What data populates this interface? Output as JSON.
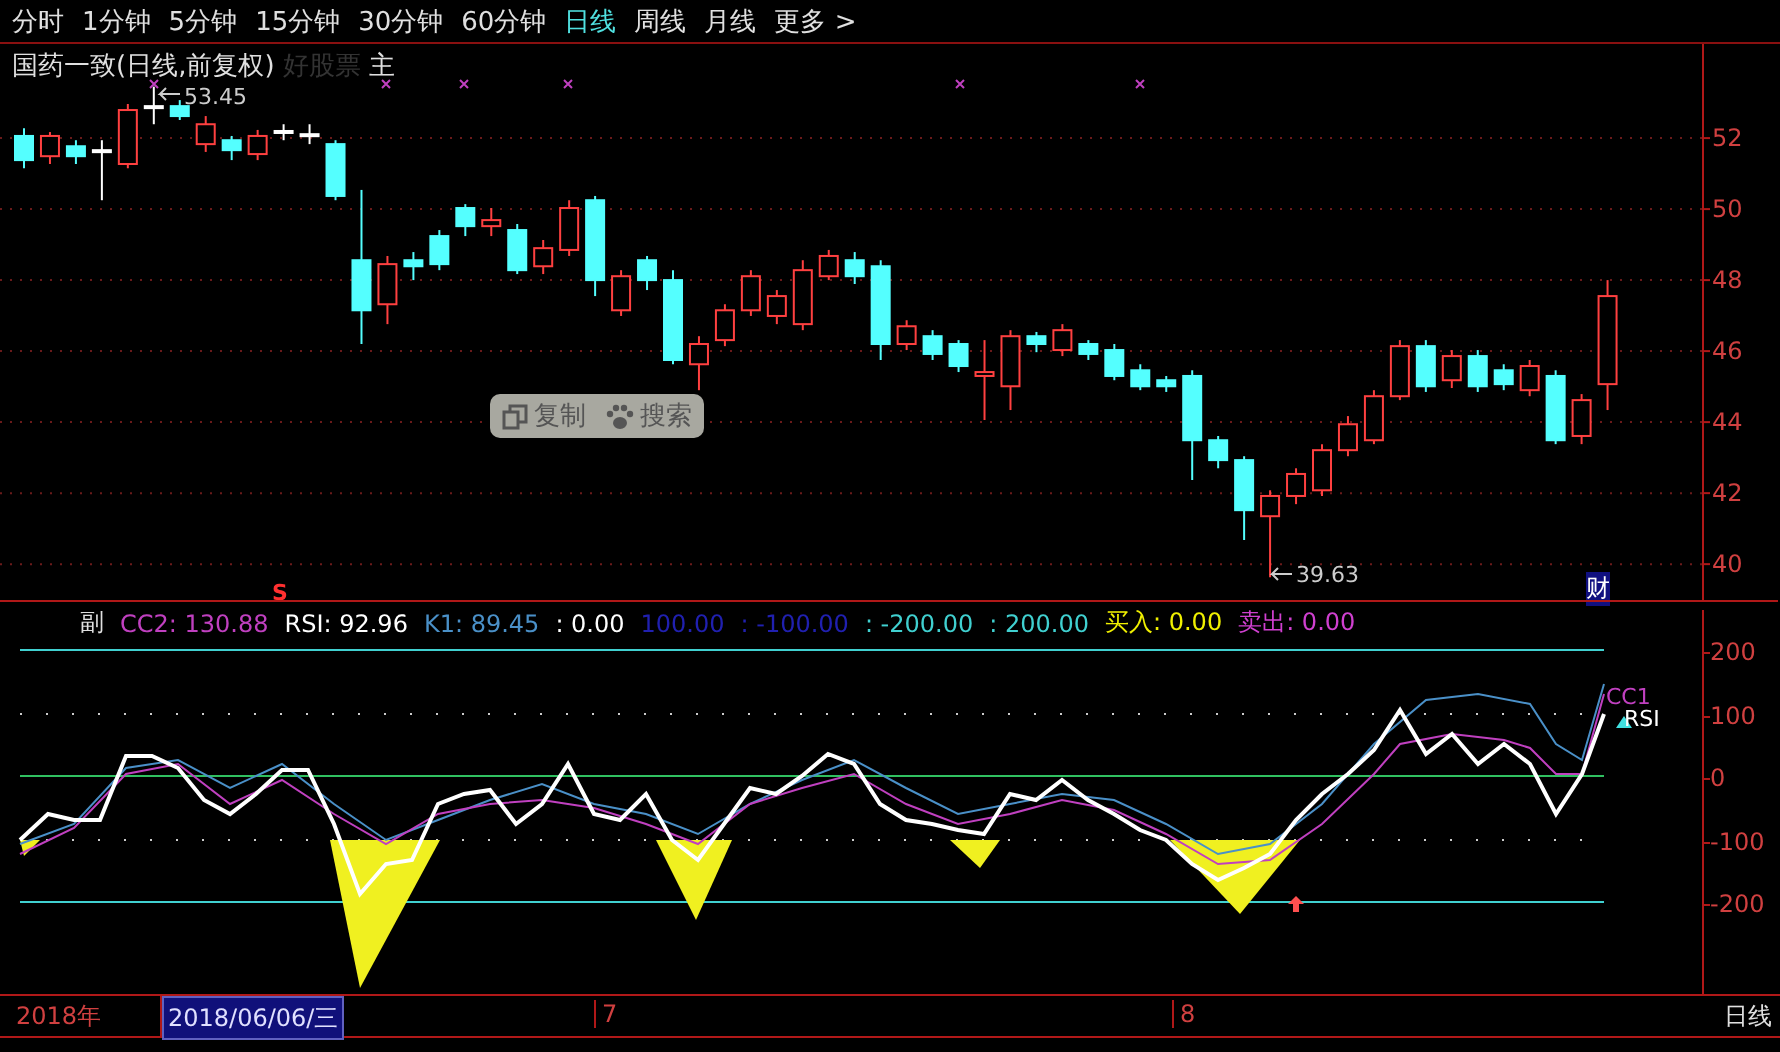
{
  "period_tabs": [
    {
      "label": "分时",
      "selected": false
    },
    {
      "label": "1分钟",
      "selected": false
    },
    {
      "label": "5分钟",
      "selected": false
    },
    {
      "label": "15分钟",
      "selected": false
    },
    {
      "label": "30分钟",
      "selected": false
    },
    {
      "label": "60分钟",
      "selected": false
    },
    {
      "label": "日线",
      "selected": true
    },
    {
      "label": "周线",
      "selected": false
    },
    {
      "label": "月线",
      "selected": false
    },
    {
      "label": "更多 >",
      "selected": false
    }
  ],
  "main_chart": {
    "title": "国药一致(日线,前复权)",
    "faint_label": "好股票",
    "main_label": "主",
    "high_label": "53.45",
    "low_label": "39.63",
    "signal_mark": "S",
    "finance_badge": "财",
    "chart_data": {
      "type": "candlestick",
      "ylim": [
        38.99,
        54.65
      ],
      "grid": true,
      "yticks": [
        52,
        50,
        48,
        46,
        44,
        42,
        40
      ],
      "ohlc": [
        [
          52.06,
          52.28,
          51.15,
          51.38
        ],
        [
          51.49,
          52.17,
          51.27,
          52.06
        ],
        [
          51.77,
          51.94,
          51.27,
          51.49
        ],
        [
          51.66,
          51.94,
          50.25,
          51.66
        ],
        [
          51.27,
          52.96,
          51.15,
          52.79
        ],
        [
          52.9,
          53.45,
          52.39,
          52.9
        ],
        [
          52.9,
          53.07,
          52.51,
          52.62
        ],
        [
          51.83,
          52.62,
          51.61,
          52.39
        ],
        [
          51.94,
          52.06,
          51.38,
          51.66
        ],
        [
          51.55,
          52.23,
          51.38,
          52.06
        ],
        [
          52.2,
          52.39,
          51.94,
          52.2
        ],
        [
          52.11,
          52.39,
          51.83,
          52.11
        ],
        [
          51.83,
          51.94,
          50.25,
          50.37
        ],
        [
          48.56,
          50.54,
          46.2,
          47.15
        ],
        [
          47.32,
          48.68,
          46.76,
          48.45
        ],
        [
          48.56,
          48.79,
          48.0,
          48.39
        ],
        [
          49.24,
          49.41,
          48.28,
          48.45
        ],
        [
          50.03,
          50.14,
          49.24,
          49.52
        ],
        [
          49.52,
          50.03,
          49.24,
          49.69
        ],
        [
          49.41,
          49.58,
          48.17,
          48.28
        ],
        [
          48.39,
          49.13,
          48.17,
          48.9
        ],
        [
          48.85,
          50.25,
          48.68,
          50.03
        ],
        [
          50.25,
          50.37,
          47.55,
          48.0
        ],
        [
          47.15,
          48.28,
          46.99,
          48.11
        ],
        [
          48.56,
          48.68,
          47.72,
          48.0
        ],
        [
          48.0,
          48.28,
          45.63,
          45.75
        ],
        [
          45.63,
          46.42,
          44.9,
          46.2
        ],
        [
          46.31,
          47.32,
          46.14,
          47.15
        ],
        [
          47.15,
          48.28,
          46.99,
          48.11
        ],
        [
          46.99,
          47.72,
          46.76,
          47.55
        ],
        [
          46.76,
          48.56,
          46.59,
          48.28
        ],
        [
          48.11,
          48.85,
          48.0,
          48.68
        ],
        [
          48.56,
          48.79,
          47.89,
          48.11
        ],
        [
          48.39,
          48.56,
          45.75,
          46.2
        ],
        [
          46.2,
          46.87,
          46.03,
          46.7
        ],
        [
          46.42,
          46.59,
          45.75,
          45.92
        ],
        [
          46.2,
          46.31,
          45.41,
          45.58
        ],
        [
          45.3,
          46.31,
          44.06,
          45.41
        ],
        [
          45.01,
          46.59,
          44.34,
          46.42
        ],
        [
          46.42,
          46.54,
          45.97,
          46.2
        ],
        [
          46.03,
          46.76,
          45.86,
          46.59
        ],
        [
          46.2,
          46.31,
          45.75,
          45.92
        ],
        [
          46.03,
          46.2,
          45.18,
          45.3
        ],
        [
          45.46,
          45.63,
          44.9,
          45.01
        ],
        [
          45.18,
          45.3,
          44.85,
          45.01
        ],
        [
          45.3,
          45.46,
          42.37,
          43.49
        ],
        [
          43.49,
          43.61,
          42.7,
          42.93
        ],
        [
          42.93,
          43.04,
          40.68,
          41.52
        ],
        [
          41.35,
          42.08,
          39.63,
          41.92
        ],
        [
          41.92,
          42.7,
          41.69,
          42.54
        ],
        [
          42.08,
          43.38,
          41.92,
          43.21
        ],
        [
          43.21,
          44.17,
          43.04,
          43.94
        ],
        [
          43.49,
          44.9,
          43.38,
          44.73
        ],
        [
          44.73,
          46.31,
          44.62,
          46.14
        ],
        [
          46.14,
          46.31,
          44.85,
          45.01
        ],
        [
          45.18,
          46.03,
          44.96,
          45.86
        ],
        [
          45.86,
          46.03,
          44.85,
          45.01
        ],
        [
          45.46,
          45.63,
          44.9,
          45.07
        ],
        [
          44.9,
          45.75,
          44.73,
          45.58
        ],
        [
          45.3,
          45.46,
          43.38,
          43.49
        ],
        [
          43.61,
          44.79,
          43.38,
          44.62
        ],
        [
          45.07,
          48.0,
          44.34,
          47.55
        ]
      ]
    }
  },
  "context_menu": {
    "buttons": [
      {
        "label": "复制"
      },
      {
        "label": "搜索"
      }
    ]
  },
  "indicator": {
    "name": "副",
    "values": [
      {
        "text": "CC2: 130.88",
        "color": "#c040c0"
      },
      {
        "text": "RSI: 92.96",
        "color": "#ffffff"
      },
      {
        "text": "K1: 89.45",
        "color": "#4a90c8"
      },
      {
        "text": ": 0.00",
        "color": "#ffffff"
      },
      {
        "text": "100.00",
        "color": "#2020b0"
      },
      {
        "text": ": -100.00",
        "color": "#2020b0"
      },
      {
        "text": ": -200.00",
        "color": "#40d0d0"
      },
      {
        "text": ": 200.00",
        "color": "#40d0d0"
      },
      {
        "text": "买入: 0.00",
        "color": "#f0f000"
      },
      {
        "text": "卖出: 0.00",
        "color": "#d040d0"
      }
    ],
    "line_labels": [
      {
        "text": "CC1",
        "color": "#c040c0"
      },
      {
        "text": "RSI",
        "color": "#ffffff"
      }
    ],
    "axis_labels": [
      "200",
      "100",
      "0",
      "-100",
      "-200"
    ]
  },
  "date_bar": {
    "year": "2018年",
    "cursor_date": "2018/06/06/三",
    "months": [
      "7",
      "8"
    ],
    "period": "日线"
  }
}
